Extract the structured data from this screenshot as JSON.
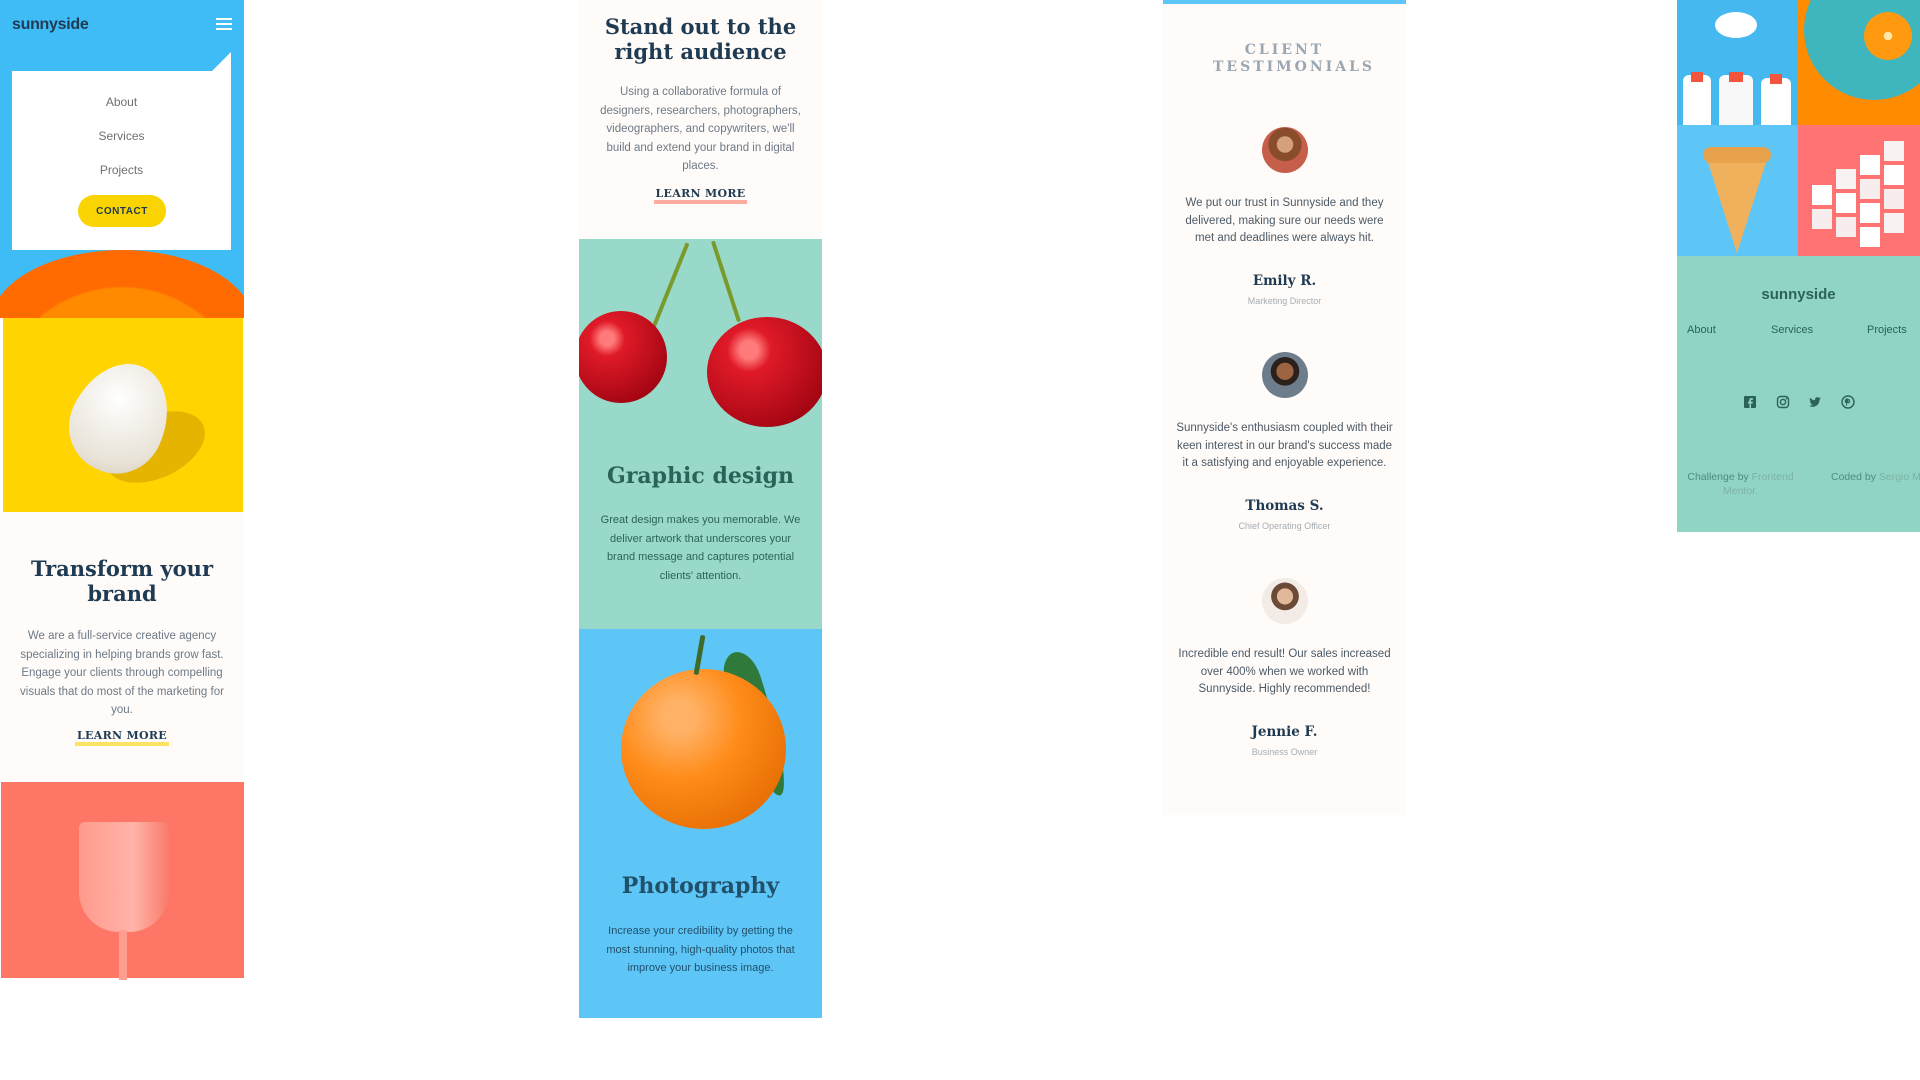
{
  "header": {
    "logo": "sunnyside",
    "nav_items": [
      "About",
      "Services",
      "Projects"
    ],
    "contact_label": "CONTACT"
  },
  "transform": {
    "title": "Transform your brand",
    "body": "We are a full-service creative agency specializing in helping brands grow fast. Engage your clients through compelling visuals that do most of the marketing for you.",
    "link": "LEARN MORE"
  },
  "standout": {
    "title": "Stand out to the right audience",
    "body": "Using a collaborative formula of designers, researchers, photographers, videographers, and copywriters, we'll build and extend your brand in digital places.",
    "link": "LEARN MORE"
  },
  "graphic": {
    "title": "Graphic design",
    "body": "Great design makes you memorable. We deliver artwork that underscores your brand message and captures potential clients' attention."
  },
  "photography": {
    "title": "Photography",
    "body": "Increase your credibility by getting the most stunning, high-quality photos that improve your business image."
  },
  "testimonials": {
    "title": "CLIENT TESTIMONIALS",
    "items": [
      {
        "quote": "We put our trust in Sunnyside and they delivered, making sure our needs were met and deadlines were always hit.",
        "name": "Emily R.",
        "role": "Marketing Director"
      },
      {
        "quote": "Sunnyside's enthusiasm coupled with their keen interest in our brand's success made it a satisfying and enjoyable experience.",
        "name": "Thomas S.",
        "role": "Chief Operating Officer"
      },
      {
        "quote": "Incredible end result! Our sales increased over 400% when we worked with Sunnyside. Highly recommended!",
        "name": "Jennie F.",
        "role": "Business Owner"
      }
    ]
  },
  "footer": {
    "logo": "sunnyside",
    "links": [
      "About",
      "Services",
      "Projects"
    ],
    "social_icons": [
      "facebook-icon",
      "instagram-icon",
      "twitter-icon",
      "pinterest-icon"
    ],
    "challenge_prefix": "Challenge by ",
    "challenge_link": "Frontend Mentor.",
    "coded_prefix": "Coded by ",
    "coded_link": "Sergio M."
  },
  "colors": {
    "accent_yellow": "#fad400",
    "hero_blue": "#3fbcf6",
    "graphic_green": "#98d9c9",
    "photo_blue": "#5ec6f7",
    "footer_green": "#90d4c5",
    "dark_blue": "#1f3b53"
  }
}
